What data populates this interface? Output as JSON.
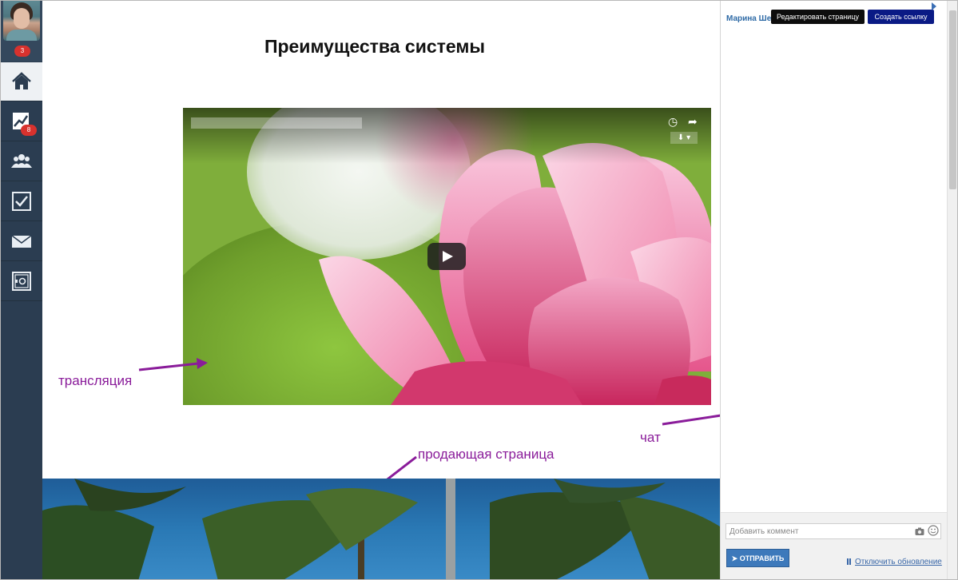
{
  "sidebar": {
    "user_badge": "3",
    "items": [
      {
        "name": "home",
        "active": true,
        "badge": ""
      },
      {
        "name": "stats",
        "active": false,
        "badge": "8"
      },
      {
        "name": "users",
        "active": false,
        "badge": ""
      },
      {
        "name": "tasks",
        "active": false,
        "badge": ""
      },
      {
        "name": "mail",
        "active": false,
        "badge": ""
      },
      {
        "name": "settings",
        "active": false,
        "badge": ""
      }
    ]
  },
  "main": {
    "page_title": "Преимущества системы",
    "annotations": {
      "broadcast": "трансляция",
      "sales_page": "продающая страница",
      "chat": "чат"
    }
  },
  "chat": {
    "author": "Марина Шев",
    "edit_button": "Редактировать страницу",
    "link_button": "Создать ссылку",
    "comment_placeholder": "Добавить коммент",
    "send_button": "ОТПРАВИТЬ",
    "toggle_update": "Отключить обновление"
  },
  "colors": {
    "sidebar": "#2b3d51",
    "annotation": "#8a1c9a",
    "send_button": "#3d79bb",
    "link_button": "#0a1a85"
  }
}
